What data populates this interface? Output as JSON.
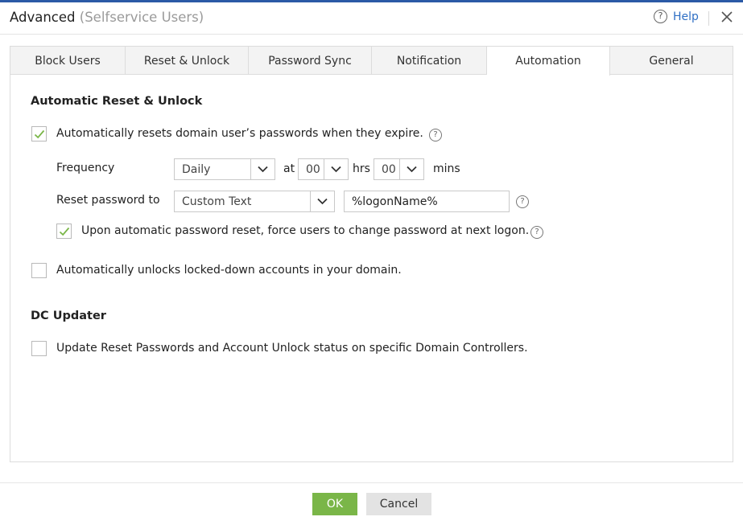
{
  "header": {
    "title": "Advanced",
    "subtitle": "(Selfservice Users)",
    "help_label": "Help",
    "help_glyph": "?",
    "close_icon": "close-icon"
  },
  "tabs": [
    {
      "label": "Block Users",
      "active": false
    },
    {
      "label": "Reset & Unlock",
      "active": false
    },
    {
      "label": "Password Sync",
      "active": false
    },
    {
      "label": "Notification",
      "active": false
    },
    {
      "label": "Automation",
      "active": true
    },
    {
      "label": "General",
      "active": false
    }
  ],
  "automation": {
    "section_title": "Automatic Reset & Unlock",
    "auto_reset": {
      "checked": true,
      "label": "Automatically resets domain user’s passwords when they expire."
    },
    "frequency": {
      "label": "Frequency",
      "value": "Daily",
      "at_label": "at",
      "hours_value": "00",
      "hrs_label": "hrs",
      "mins_value": "00",
      "mins_label": "mins"
    },
    "reset_password": {
      "label": "Reset password to",
      "type_value": "Custom Text",
      "text_value": "%logonName%"
    },
    "force_change": {
      "checked": true,
      "label": "Upon automatic password reset, force users to change password at next logon."
    },
    "auto_unlock": {
      "checked": false,
      "label": "Automatically unlocks locked-down accounts in your domain."
    }
  },
  "dc_updater": {
    "section_title": "DC Updater",
    "update_status": {
      "checked": false,
      "label": "Update Reset Passwords and Account Unlock status on specific Domain Controllers."
    }
  },
  "footer": {
    "ok_label": "OK",
    "cancel_label": "Cancel"
  },
  "colors": {
    "accent_blue": "#2b5aa6",
    "link_blue": "#2f6fc4",
    "check_green": "#7ab648",
    "ok_green": "#7ab648"
  },
  "help_marker": "?"
}
